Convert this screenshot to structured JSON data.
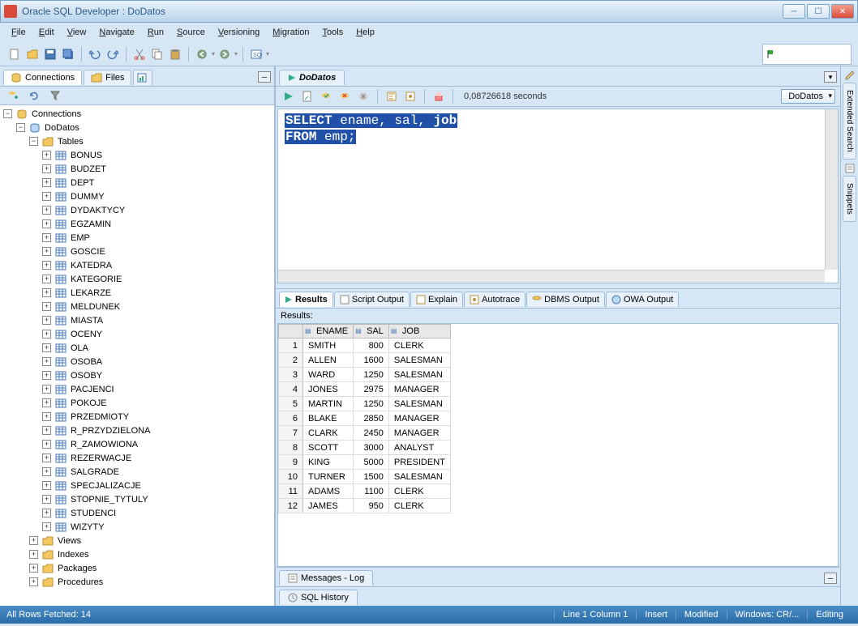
{
  "window_title": "Oracle SQL Developer : DoDatos",
  "menubar": [
    "File",
    "Edit",
    "View",
    "Navigate",
    "Run",
    "Source",
    "Versioning",
    "Migration",
    "Tools",
    "Help"
  ],
  "left_tabs": {
    "connections": "Connections",
    "files": "Files"
  },
  "tree_root": "Connections",
  "connection_name": "DoDatos",
  "tables_label": "Tables",
  "tables": [
    "BONUS",
    "BUDZET",
    "DEPT",
    "DUMMY",
    "DYDAKTYCY",
    "EGZAMIN",
    "EMP",
    "GOSCIE",
    "KATEDRA",
    "KATEGORIE",
    "LEKARZE",
    "MELDUNEK",
    "MIASTA",
    "OCENY",
    "OLA",
    "OSOBA",
    "OSOBY",
    "PACJENCI",
    "POKOJE",
    "PRZEDMIOTY",
    "R_PRZYDZIELONA",
    "R_ZAMOWIONA",
    "REZERWACJE",
    "SALGRADE",
    "SPECJALIZACJE",
    "STOPNIE_TYTULY",
    "STUDENCI",
    "WIZYTY"
  ],
  "other_nodes": [
    "Views",
    "Indexes",
    "Packages",
    "Procedures"
  ],
  "editor_tab": "DoDatos",
  "exec_time": "0,08726618 seconds",
  "conn_dropdown": "DoDatos",
  "sql": {
    "line1_kw": "SELECT",
    "line1_rest": " ename, sal, ",
    "line1_bold": "job",
    "line2_kw": "FROM",
    "line2_rest": " emp;"
  },
  "results_tabs": [
    "Results",
    "Script Output",
    "Explain",
    "Autotrace",
    "DBMS Output",
    "OWA Output"
  ],
  "results_label": "Results:",
  "grid_cols": [
    "ENAME",
    "SAL",
    "JOB"
  ],
  "grid_rows": [
    {
      "n": 1,
      "ename": "SMITH",
      "sal": 800,
      "job": "CLERK"
    },
    {
      "n": 2,
      "ename": "ALLEN",
      "sal": 1600,
      "job": "SALESMAN"
    },
    {
      "n": 3,
      "ename": "WARD",
      "sal": 1250,
      "job": "SALESMAN"
    },
    {
      "n": 4,
      "ename": "JONES",
      "sal": 2975,
      "job": "MANAGER"
    },
    {
      "n": 5,
      "ename": "MARTIN",
      "sal": 1250,
      "job": "SALESMAN"
    },
    {
      "n": 6,
      "ename": "BLAKE",
      "sal": 2850,
      "job": "MANAGER"
    },
    {
      "n": 7,
      "ename": "CLARK",
      "sal": 2450,
      "job": "MANAGER"
    },
    {
      "n": 8,
      "ename": "SCOTT",
      "sal": 3000,
      "job": "ANALYST"
    },
    {
      "n": 9,
      "ename": "KING",
      "sal": 5000,
      "job": "PRESIDENT"
    },
    {
      "n": 10,
      "ename": "TURNER",
      "sal": 1500,
      "job": "SALESMAN"
    },
    {
      "n": 11,
      "ename": "ADAMS",
      "sal": 1100,
      "job": "CLERK"
    },
    {
      "n": 12,
      "ename": "JAMES",
      "sal": 950,
      "job": "CLERK"
    }
  ],
  "messages_tab": "Messages - Log",
  "sql_history_tab": "SQL History",
  "side_tabs": [
    "Extended Search",
    "Snippets"
  ],
  "status": {
    "fetch": "All Rows Fetched: 14",
    "pos": "Line 1 Column 1",
    "mode": "Insert",
    "modified": "Modified",
    "platform": "Windows: CR/...",
    "editing": "Editing"
  }
}
